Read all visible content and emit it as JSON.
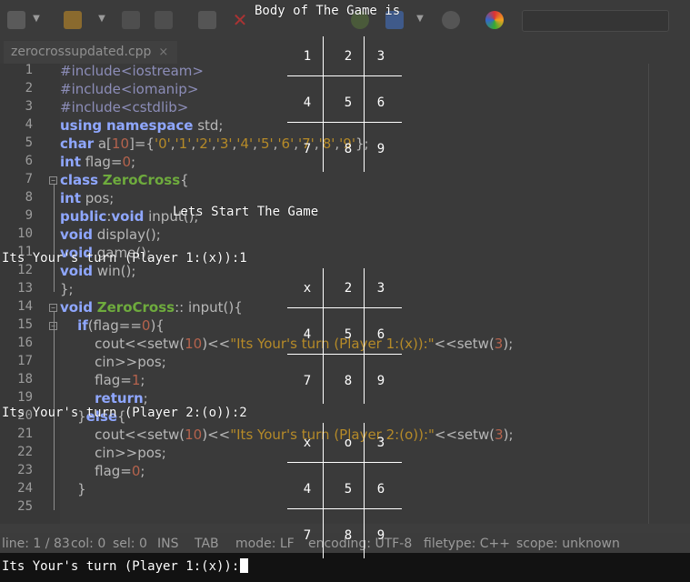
{
  "editor": {
    "tab": {
      "label": "zerocrossupdated.cpp",
      "close": "×"
    },
    "toolbar": {
      "icons": [
        "new-file-icon",
        "open-folder-icon",
        "save-icon",
        "save-all-icon",
        "revert-icon",
        "close-icon",
        "back-icon",
        "forward-icon",
        "compile-icon",
        "build-icon",
        "run-icon",
        "preferences-icon",
        "color-chooser-icon"
      ],
      "dropdown_arrow": "▼"
    },
    "line_numbers": [
      "1",
      "2",
      "3",
      "4",
      "5",
      "6",
      "7",
      "8",
      "9",
      "10",
      "11",
      "12",
      "13",
      "14",
      "15",
      "16",
      "17",
      "18",
      "19",
      "20",
      "21",
      "22",
      "23",
      "24",
      "25"
    ],
    "code": [
      "#include<iostream>",
      "#include<iomanip>",
      "#include<cstdlib>",
      "using namespace std;",
      "char a[10]={'0','1','2','3','4','5','6','7','8','9'};",
      "int flag=0;",
      "class ZeroCross{",
      "int pos;",
      "public:void input();",
      "void display();",
      "void game();",
      "void win();",
      "};",
      "void ZeroCross:: input(){",
      "    if(flag==0){",
      "        cout<<setw(10)<<\"Its Your's turn (Player 1:(x)):\"<<setw(3);",
      "        cin>>pos;",
      "        flag=1;",
      "        return;",
      "    }else{",
      "        cout<<setw(10)<<\"Its Your's turn (Player 2:(o)):\"<<setw(3);",
      "        cin>>pos;",
      "        flag=0;",
      "    }",
      ""
    ],
    "status": {
      "line": "line: 1 / 83",
      "col": "col: 0",
      "sel": "sel: 0",
      "ins": "INS",
      "tab": "TAB",
      "mode": "mode: LF",
      "encoding": "encoding: UTF-8",
      "filetype": "filetype: C++",
      "scope": "scope: unknown"
    },
    "colors": {
      "keyword": "#8fa7ff",
      "string": "#b58a28",
      "class": "#6eab3d",
      "number": "#b5634d",
      "preprocessor": "#8c8db8"
    }
  },
  "terminal": {
    "header": "Body of The Game is",
    "start_message": "Lets Start The Game",
    "board1": [
      "1",
      "2",
      "3",
      "4",
      "5",
      "6",
      "7",
      "8",
      "9"
    ],
    "turn1": "Its Your's turn (Player 1:(x)):1",
    "board2": [
      "x",
      "2",
      "3",
      "4",
      "5",
      "6",
      "7",
      "8",
      "9"
    ],
    "turn2": "Its Your's turn (Player 2:(o)):2",
    "board3": [
      "x",
      "o",
      "3",
      "4",
      "5",
      "6",
      "7",
      "8",
      "9"
    ],
    "prompt": "Its Your's turn (Player 1:(x)):"
  }
}
